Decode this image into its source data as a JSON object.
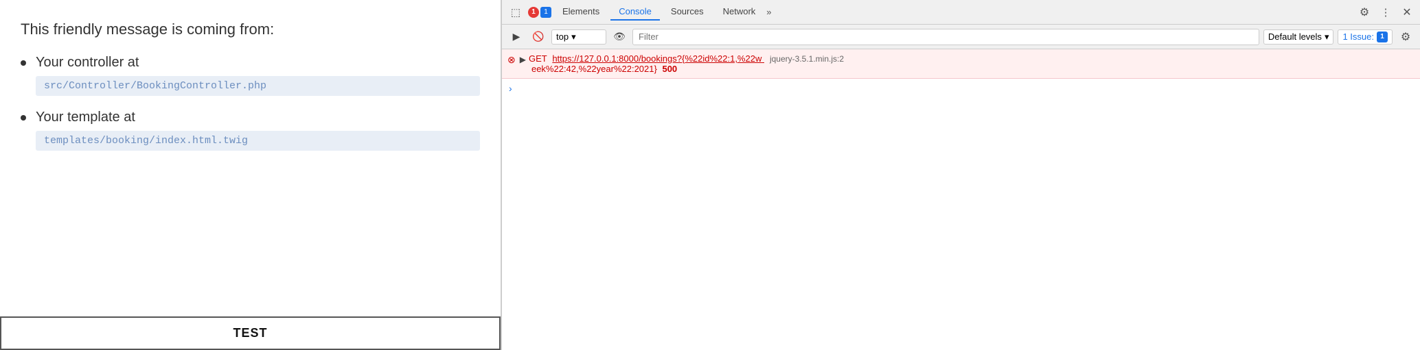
{
  "left": {
    "intro_text": "This friendly message is coming from:",
    "items": [
      {
        "label": "Your controller at",
        "path": "src/Controller/BookingController.php"
      },
      {
        "label": "Your template at",
        "path": "templates/booking/index.html.twig"
      }
    ],
    "test_label": "TEST"
  },
  "devtools": {
    "tabs": [
      {
        "label": "Elements",
        "active": false
      },
      {
        "label": "Console",
        "active": true
      },
      {
        "label": "Sources",
        "active": false
      },
      {
        "label": "Network",
        "active": false
      }
    ],
    "console": {
      "context": "top",
      "filter_placeholder": "Filter",
      "levels_label": "Default levels",
      "issue_label": "1 Issue:",
      "issue_count": "1",
      "error": {
        "method": "GET",
        "url": "https://127.0.0.1:8000/bookings?{%22id%22:1,%22w",
        "url2": "eek%22:42,%22year%22:2021}",
        "status_code": "500",
        "source": "jquery-3.5.1.min.js:2"
      }
    },
    "icons": {
      "cursor": "⬚",
      "circle_slash": "🚫",
      "eye": "👁",
      "more": "»",
      "gear": "⚙",
      "close": "✕",
      "play": "▶",
      "down_arrow": "▾",
      "right_arrow": "▸",
      "chevron_right": ">"
    }
  }
}
